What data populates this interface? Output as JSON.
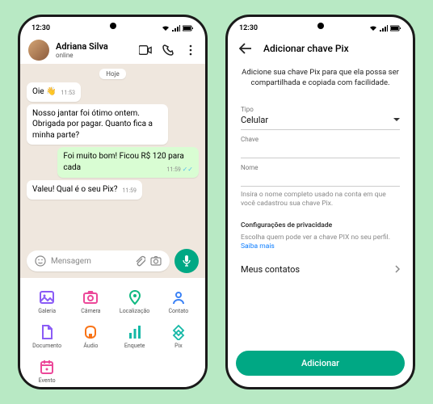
{
  "status": {
    "time": "12:30"
  },
  "chat": {
    "contact_name": "Adriana Silva",
    "contact_status": "online",
    "date_label": "Hoje",
    "messages": [
      {
        "dir": "in",
        "text": "Oie 👋",
        "time": "11:53"
      },
      {
        "dir": "in",
        "text": "Nosso jantar foi ótimo ontem. Obrigada por pagar. Quanto fica a minha parte?",
        "time": ""
      },
      {
        "dir": "out",
        "text": "Foi muito bom! Ficou R$ 120 para cada",
        "time": "11:59"
      },
      {
        "dir": "in",
        "text": "Valeu! Qual é o seu Pix?",
        "time": "11:59"
      }
    ],
    "input_placeholder": "Mensagem",
    "attachments": [
      {
        "label": "Galeria",
        "name": "gallery-icon",
        "color": "#8b5cf6"
      },
      {
        "label": "Câmera",
        "name": "camera-icon",
        "color": "#ec4899"
      },
      {
        "label": "Localização",
        "name": "location-icon",
        "color": "#10b981"
      },
      {
        "label": "Contato",
        "name": "contact-icon",
        "color": "#3b82f6"
      },
      {
        "label": "Documento",
        "name": "document-icon",
        "color": "#8b5cf6"
      },
      {
        "label": "Áudio",
        "name": "audio-icon",
        "color": "#f97316"
      },
      {
        "label": "Enquete",
        "name": "poll-icon",
        "color": "#14b8a6"
      },
      {
        "label": "Pix",
        "name": "pix-icon",
        "color": "#14b8a6"
      },
      {
        "label": "Evento",
        "name": "event-icon",
        "color": "#ec4899"
      }
    ]
  },
  "pix": {
    "screen_title": "Adicionar chave Pix",
    "intro": "Adicione sua chave Pix para que ela possa ser compartilhada e copiada com facilidade.",
    "type_label": "Tipo",
    "type_value": "Celular",
    "key_label": "Chave",
    "name_label": "Nome",
    "name_helper": "Insira o nome completo usado na conta em que você cadastrou sua chave Pix.",
    "privacy_heading": "Configurações de privacidade",
    "privacy_text": "Escolha quem pode ver a chave PIX no seu perfil.",
    "privacy_link": "Saiba mais",
    "contacts_label": "Meus contatos",
    "add_button": "Adicionar"
  }
}
